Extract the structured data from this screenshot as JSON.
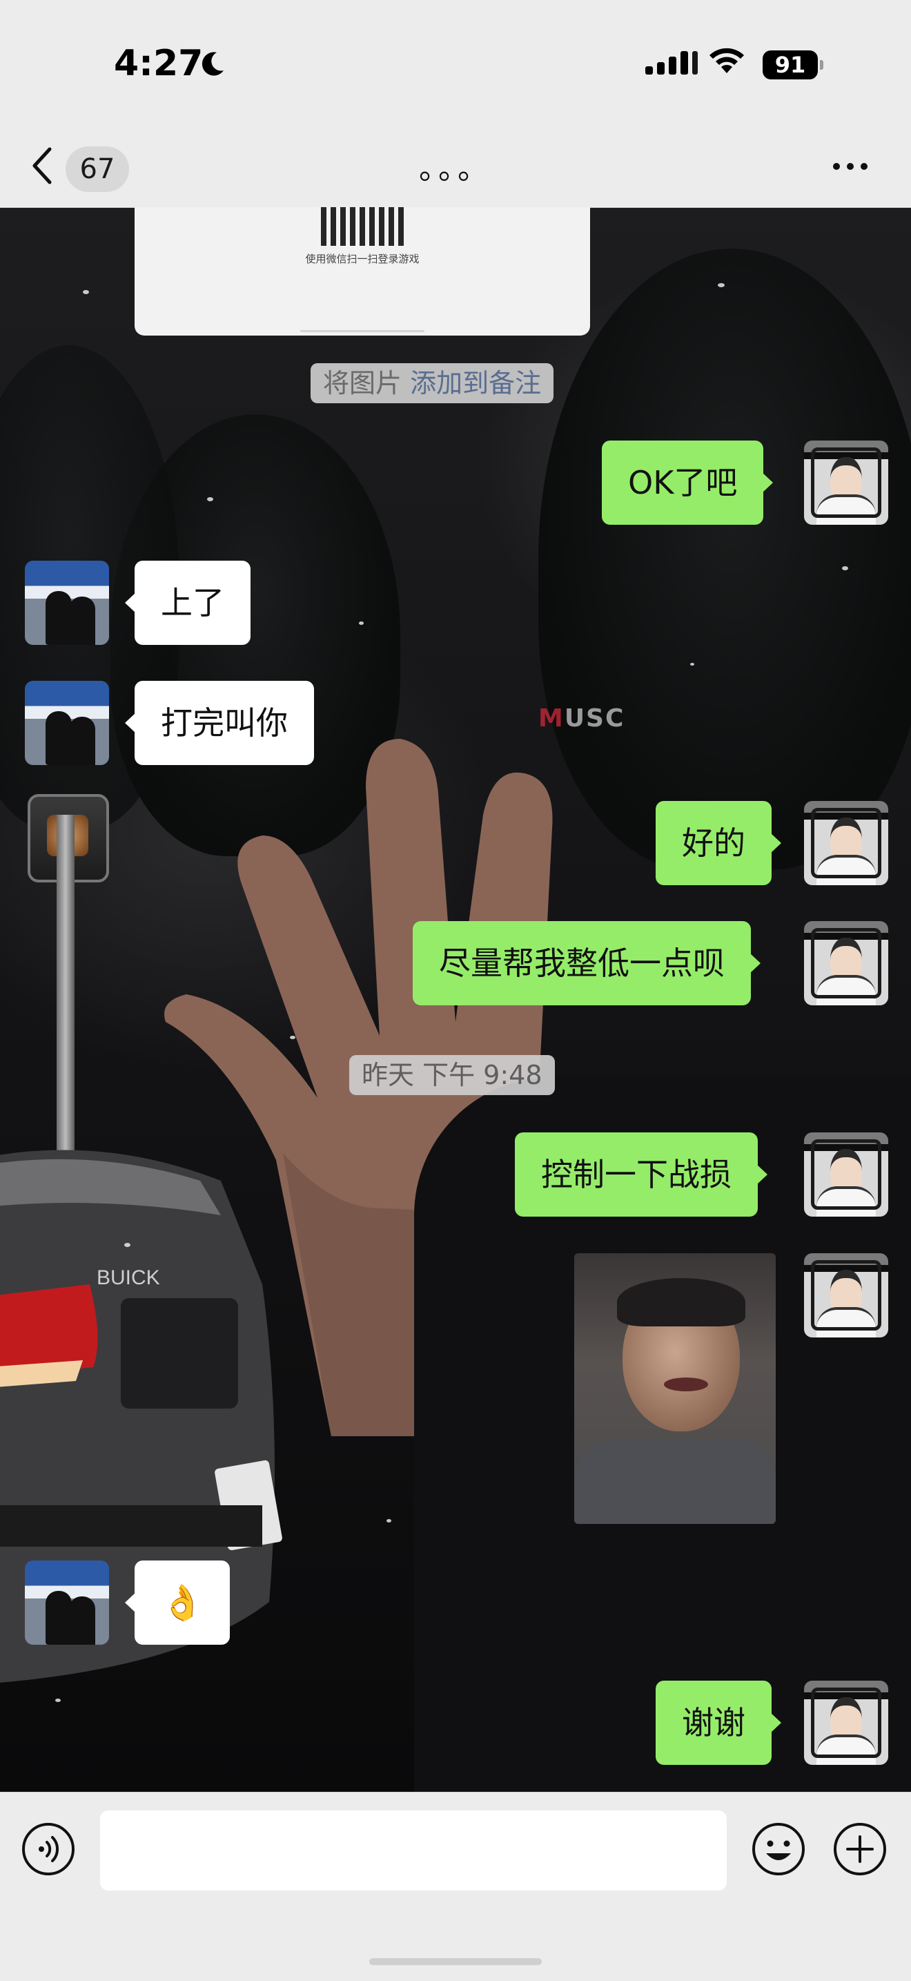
{
  "status_bar": {
    "time": "4:27",
    "battery": "91"
  },
  "nav": {
    "unread_count": "67",
    "title": "。。。"
  },
  "shared_card": {
    "caption": "使用微信扫一扫登录游戏"
  },
  "notice": {
    "prefix": "将图片",
    "link": "添加到备注"
  },
  "messages": [
    {
      "sender": "me",
      "text": "OK了吧"
    },
    {
      "sender": "other",
      "text": "上了"
    },
    {
      "sender": "other",
      "text": "打完叫你"
    },
    {
      "sender": "me",
      "text": "好的"
    },
    {
      "sender": "me",
      "text": "尽量帮我整低一点呗"
    },
    {
      "sender": "me",
      "text": "控制一下战损"
    },
    {
      "sender": "me",
      "type": "image"
    },
    {
      "sender": "other",
      "text": "👌"
    },
    {
      "sender": "me",
      "text": "谢谢"
    }
  ],
  "timestamp": "昨天 下午 9:48",
  "background_sign": {
    "brand": "M",
    "text": "USC"
  },
  "input": {
    "placeholder": ""
  },
  "colors": {
    "my_bubble": "#95ec69",
    "their_bubble": "#ffffff",
    "bar_bg": "#ececec",
    "link": "#5a6d91"
  },
  "icons": [
    "back-icon",
    "more-icon",
    "voice-icon",
    "emoji-icon",
    "plus-icon",
    "moon-icon",
    "wifi-icon",
    "signal-icon",
    "battery-icon"
  ]
}
